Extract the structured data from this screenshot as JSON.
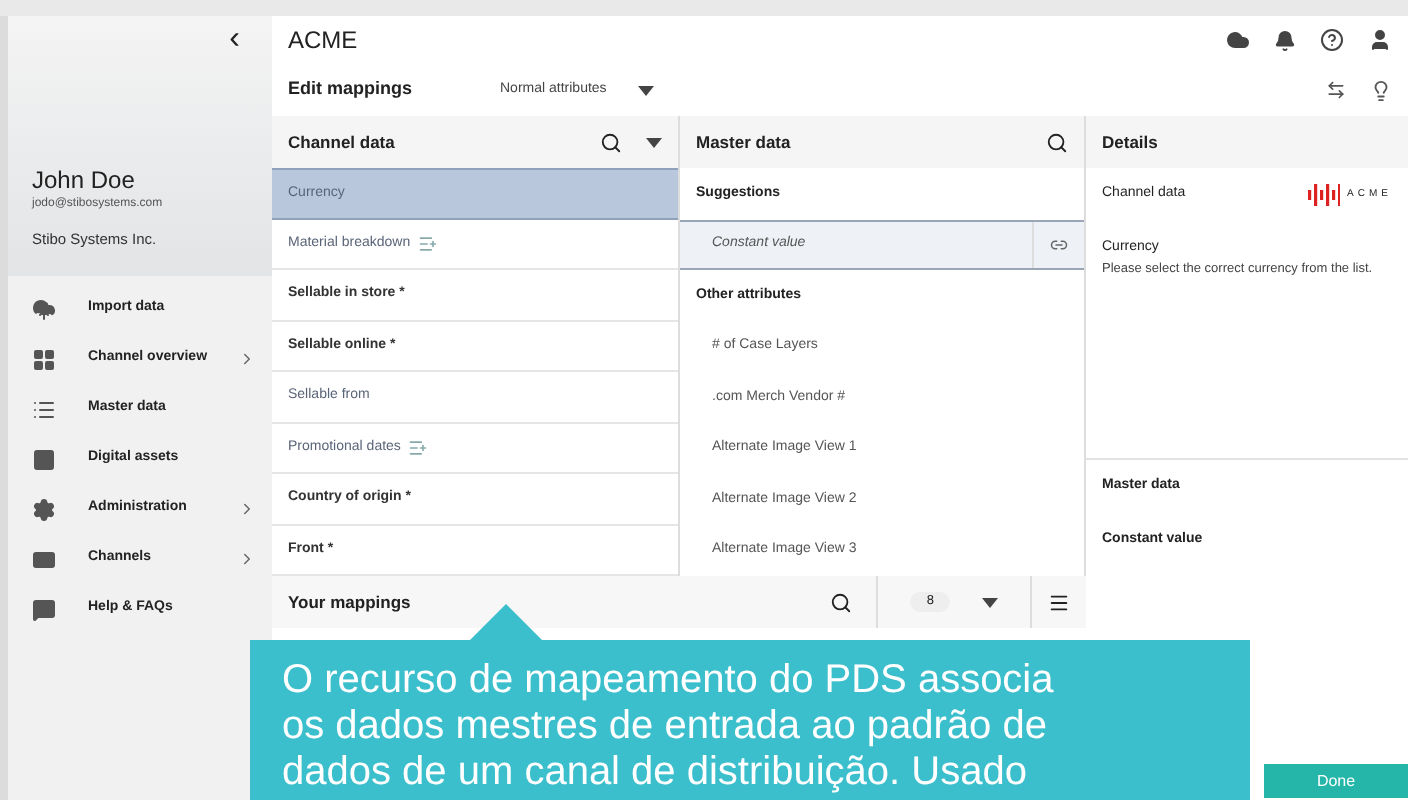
{
  "sidebar": {
    "collapse_glyph": "‹",
    "user": {
      "name": "John Doe",
      "email": "jodo@stibosystems.com",
      "company": "Stibo Systems Inc."
    },
    "items": [
      {
        "label": "Import data",
        "expandable": false
      },
      {
        "label": "Channel overview",
        "expandable": true
      },
      {
        "label": "Master data",
        "expandable": false
      },
      {
        "label": "Digital assets",
        "expandable": false
      },
      {
        "label": "Administration",
        "expandable": true
      },
      {
        "label": "Channels",
        "expandable": true
      },
      {
        "label": "Help & FAQs",
        "expandable": false
      }
    ]
  },
  "header": {
    "title": "ACME"
  },
  "toolbar": {
    "title": "Edit mappings",
    "filter": "Normal attributes"
  },
  "channel_data": {
    "title": "Channel data",
    "rows": [
      {
        "label": "Currency",
        "required": false,
        "addable": false,
        "selected": true
      },
      {
        "label": "Material breakdown",
        "required": false,
        "addable": true,
        "selected": false
      },
      {
        "label": "Sellable in store *",
        "required": true,
        "addable": false,
        "selected": false
      },
      {
        "label": "Sellable online *",
        "required": true,
        "addable": false,
        "selected": false
      },
      {
        "label": "Sellable from",
        "required": false,
        "addable": false,
        "selected": false
      },
      {
        "label": "Promotional dates",
        "required": false,
        "addable": true,
        "selected": false
      },
      {
        "label": "Country of origin *",
        "required": true,
        "addable": false,
        "selected": false
      },
      {
        "label": "Front *",
        "required": true,
        "addable": false,
        "selected": false
      }
    ]
  },
  "master_data": {
    "title": "Master data",
    "rows": [
      {
        "kind": "section",
        "label": "Suggestions"
      },
      {
        "kind": "link",
        "label": "Constant value",
        "selected": true
      },
      {
        "kind": "section",
        "label": "Other attributes"
      },
      {
        "kind": "item",
        "label": "# of Case Layers"
      },
      {
        "kind": "item",
        "label": ".com Merch Vendor #"
      },
      {
        "kind": "item",
        "label": "Alternate Image View 1"
      },
      {
        "kind": "item",
        "label": "Alternate Image View 2"
      },
      {
        "kind": "item",
        "label": "Alternate Image View 3"
      }
    ]
  },
  "mappings_bar": {
    "title": "Your mappings",
    "count": "8"
  },
  "details": {
    "title": "Details",
    "channel_label": "Channel data",
    "logo_text": "ACME",
    "field": "Currency",
    "description": "Please select the correct currency from the list.",
    "master_label": "Master data",
    "master_value": "Constant value",
    "done": "Done"
  },
  "callout": {
    "text": "O recurso de mapeamento do PDS associa os dados mestres de entrada ao padrão de dados de um canal de distribuição. Usado"
  }
}
